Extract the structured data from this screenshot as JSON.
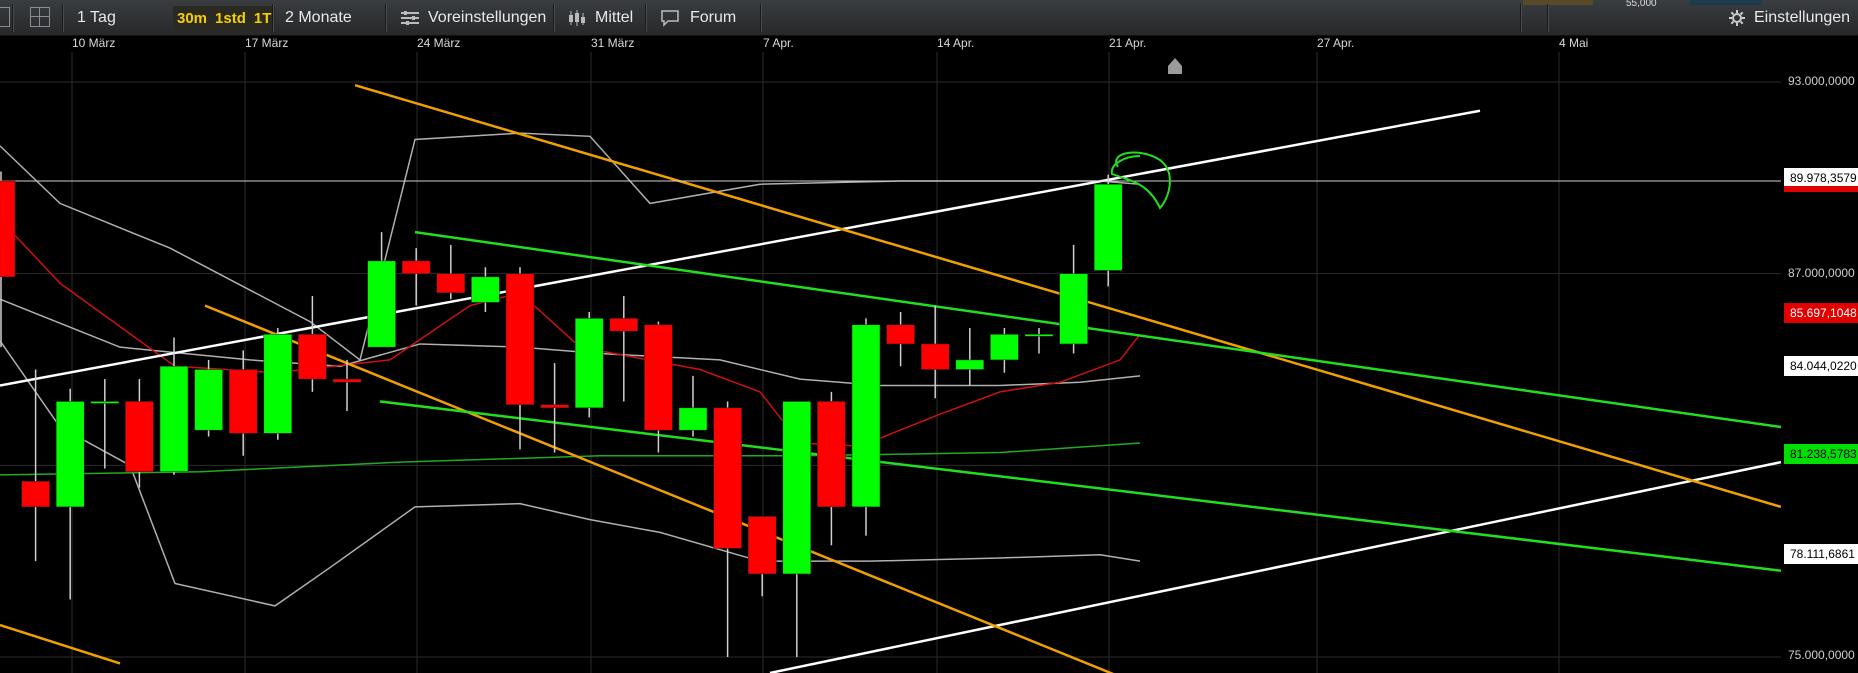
{
  "toolbar": {
    "period": "1 Tag",
    "timeframes": [
      "30m",
      "1std",
      "1T"
    ],
    "range": "2 Monate",
    "presets": "Voreinstellungen",
    "indicator": "Mittel",
    "forum": "Forum",
    "settings": "Einstellungen",
    "top_right_value": "55,000"
  },
  "date_axis": [
    "10 März",
    "17 März",
    "24 März",
    "31 März",
    "7 Apr.",
    "14 Apr.",
    "21 Apr.",
    "27 Apr.",
    "4 Mai"
  ],
  "price_axis": [
    "93.000,0000",
    "87.000,0000",
    "75.000,0000"
  ],
  "price_tags": [
    {
      "label": "89.978,3579",
      "bg": "#ffffff",
      "fg": "#000000"
    },
    {
      "label": "85.697,1048",
      "bg": "#e00000",
      "fg": "#ffffff"
    },
    {
      "label": "84.044,0220",
      "bg": "#ffffff",
      "fg": "#000000"
    },
    {
      "label": "81.238,5783",
      "bg": "#00e000",
      "fg": "#000000"
    },
    {
      "label": "78.111,6861",
      "bg": "#ffffff",
      "fg": "#000000"
    }
  ],
  "colors": {
    "up": "#00ff00",
    "down": "#ff0000",
    "orange_trend": "#f0a000",
    "green_trend": "#22dd22",
    "white_trend": "#ffffff",
    "bollinger": "#b0b0b0",
    "ma_short": "#cc1111",
    "ma_long": "#22aa22",
    "grid": "#2b2b2b"
  },
  "chart_data": {
    "type": "candlestick",
    "x_ticks": [
      "10 März",
      "17 März",
      "24 März",
      "31 März",
      "7 Apr.",
      "14 Apr.",
      "21 Apr.",
      "27 Apr.",
      "4 Mai"
    ],
    "y_ticks": [
      93000,
      87000,
      75000
    ],
    "ylim": [
      75000,
      93000
    ],
    "grid": true,
    "candles": [
      {
        "o": 89900,
        "c": 86900,
        "h": 90200,
        "l": 84700
      },
      {
        "o": 80500,
        "c": 79700,
        "h": 84000,
        "l": 78000
      },
      {
        "o": 79700,
        "c": 83000,
        "h": 83400,
        "l": 76800
      },
      {
        "o": 83000,
        "c": 83000,
        "h": 83700,
        "l": 80900
      },
      {
        "o": 83000,
        "c": 80800,
        "h": 83700,
        "l": 80300
      },
      {
        "o": 80800,
        "c": 84100,
        "h": 85000,
        "l": 80700
      },
      {
        "o": 82100,
        "c": 84000,
        "h": 84300,
        "l": 81900
      },
      {
        "o": 84000,
        "c": 82000,
        "h": 84600,
        "l": 81300
      },
      {
        "o": 82000,
        "c": 85100,
        "h": 85300,
        "l": 81800
      },
      {
        "o": 85100,
        "c": 83700,
        "h": 86300,
        "l": 83300
      },
      {
        "o": 83700,
        "c": 83600,
        "h": 84300,
        "l": 82700
      },
      {
        "o": 84700,
        "c": 87400,
        "h": 88300,
        "l": 84700
      },
      {
        "o": 87400,
        "c": 87000,
        "h": 87800,
        "l": 86000
      },
      {
        "o": 87000,
        "c": 86400,
        "h": 87900,
        "l": 86200
      },
      {
        "o": 86100,
        "c": 86900,
        "h": 87200,
        "l": 85800
      },
      {
        "o": 87000,
        "c": 82900,
        "h": 87200,
        "l": 81500
      },
      {
        "o": 82900,
        "c": 82800,
        "h": 84200,
        "l": 81400
      },
      {
        "o": 82800,
        "c": 85600,
        "h": 85800,
        "l": 82500
      },
      {
        "o": 85600,
        "c": 85200,
        "h": 86300,
        "l": 83000
      },
      {
        "o": 85400,
        "c": 82100,
        "h": 85500,
        "l": 81400
      },
      {
        "o": 82100,
        "c": 82800,
        "h": 83800,
        "l": 81900
      },
      {
        "o": 82800,
        "c": 78400,
        "h": 83000,
        "l": 75000
      },
      {
        "o": 79400,
        "c": 77600,
        "h": 79400,
        "l": 76900
      },
      {
        "o": 77600,
        "c": 83000,
        "h": 83000,
        "l": 75000
      },
      {
        "o": 83000,
        "c": 79700,
        "h": 83300,
        "l": 78500
      },
      {
        "o": 79700,
        "c": 85400,
        "h": 85600,
        "l": 78800
      },
      {
        "o": 85400,
        "c": 84800,
        "h": 85800,
        "l": 84100
      },
      {
        "o": 84800,
        "c": 84000,
        "h": 86000,
        "l": 83100
      },
      {
        "o": 84000,
        "c": 84300,
        "h": 85300,
        "l": 83500
      },
      {
        "o": 84300,
        "c": 85100,
        "h": 85300,
        "l": 83900
      },
      {
        "o": 85100,
        "c": 85100,
        "h": 85300,
        "l": 84500
      },
      {
        "o": 84800,
        "c": 87000,
        "h": 87900,
        "l": 84500
      },
      {
        "o": 87100,
        "c": 89800,
        "h": 90100,
        "l": 86600
      }
    ]
  }
}
